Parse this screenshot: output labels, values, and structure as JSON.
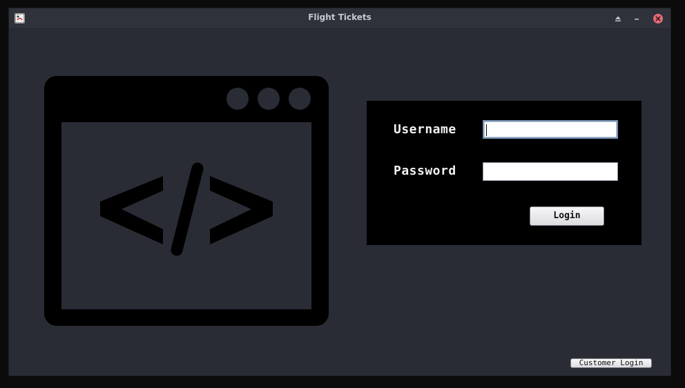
{
  "window": {
    "title": "Flight Tickets",
    "app_icon": "java-app-icon",
    "controls": {
      "maximize_icon": "eject-icon",
      "minimize_icon": "minimize-icon",
      "close_icon": "close-icon"
    }
  },
  "illustration": {
    "icon": "code-window-icon",
    "symbol": "</>"
  },
  "login_form": {
    "username_label": "Username",
    "username_value": "",
    "password_label": "Password",
    "password_value": "",
    "login_button": "Login"
  },
  "customer_login_button": "Customer Login",
  "colors": {
    "window_background": "#2a2c35",
    "panel_background": "#000000",
    "close_button": "#e06c75",
    "label_text": "#f2f2f2"
  }
}
